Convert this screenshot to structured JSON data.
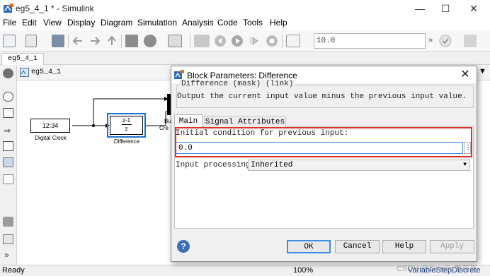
{
  "window": {
    "title": "eg5_4_1 * - Simulink",
    "minimize": "—",
    "maximize": "☐",
    "close": "✕"
  },
  "menu": [
    "File",
    "Edit",
    "View",
    "Display",
    "Diagram",
    "Simulation",
    "Analysis",
    "Code",
    "Tools",
    "Help"
  ],
  "toolbar": {
    "stop_time": "10.0",
    "overflow": "»"
  },
  "tabs": {
    "model_tab": "eg5_4_1"
  },
  "breadcrumb": {
    "model": "eg5_4_1"
  },
  "diagram": {
    "clock_display": "12:34",
    "clock_label": "Digital Clock",
    "diff_num": "z-1",
    "diff_den": "z",
    "diff_label": "Difference",
    "partial_block_label1": "Bu",
    "partial_block_label2": "Cre"
  },
  "status": {
    "left": "Ready",
    "zoom": "100%",
    "solver": "VariableStepDiscrete",
    "watermark": "CSDN @Zevalin爱灰灰"
  },
  "dialog": {
    "title": "Block Parameters: Difference",
    "mask_title": "Difference (mask) (link)",
    "description": "Output the current input value minus the previous input value.",
    "tab_main": "Main",
    "tab_signal": "Signal Attributes",
    "initial_condition_label": "Initial condition for previous input:",
    "initial_condition_value": "0.0",
    "more_button": "⋮",
    "input_processing_label": "Input processing:",
    "input_processing_value": "Inherited",
    "help_icon_text": "?",
    "buttons": {
      "ok": "OK",
      "cancel": "Cancel",
      "help": "Help",
      "apply": "Apply"
    }
  },
  "colors": {
    "highlight_box": "#e0302b",
    "help_icon": "#3d6fb7",
    "selected_block": "#1f6fd1"
  }
}
